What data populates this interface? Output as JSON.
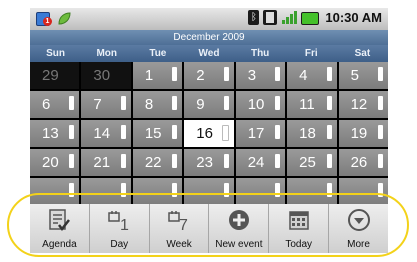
{
  "status": {
    "time": "10:30 AM",
    "notification_badge": "1",
    "icons": [
      "calendar-notification-icon",
      "leaf-icon",
      "bluetooth-icon",
      "phone-icon",
      "signal-icon",
      "battery-icon"
    ]
  },
  "calendar": {
    "month_title": "December 2009",
    "day_names": [
      "Sun",
      "Mon",
      "Tue",
      "Wed",
      "Thu",
      "Fri",
      "Sat"
    ],
    "weeks": [
      [
        "29",
        "30",
        "1",
        "2",
        "3",
        "4",
        "5"
      ],
      [
        "6",
        "7",
        "8",
        "9",
        "10",
        "11",
        "12"
      ],
      [
        "13",
        "14",
        "15",
        "16",
        "17",
        "18",
        "19"
      ],
      [
        "20",
        "21",
        "22",
        "23",
        "24",
        "25",
        "26"
      ],
      [
        "",
        "",
        "",
        "",
        "",
        "",
        ""
      ]
    ],
    "prev_month_days": [
      "29",
      "30"
    ],
    "today": "16"
  },
  "menu": {
    "items": [
      {
        "label": "Agenda",
        "icon": "agenda-icon"
      },
      {
        "label": "Day",
        "icon": "day-icon"
      },
      {
        "label": "Week",
        "icon": "week-icon"
      },
      {
        "label": "New event",
        "icon": "add-icon"
      },
      {
        "label": "Today",
        "icon": "today-icon"
      },
      {
        "label": "More",
        "icon": "chevron-down-icon"
      }
    ]
  },
  "colors": {
    "highlight": "#f3d21a",
    "header_blue": "#4e6f96",
    "cell_gray": "#8a8a8a"
  }
}
